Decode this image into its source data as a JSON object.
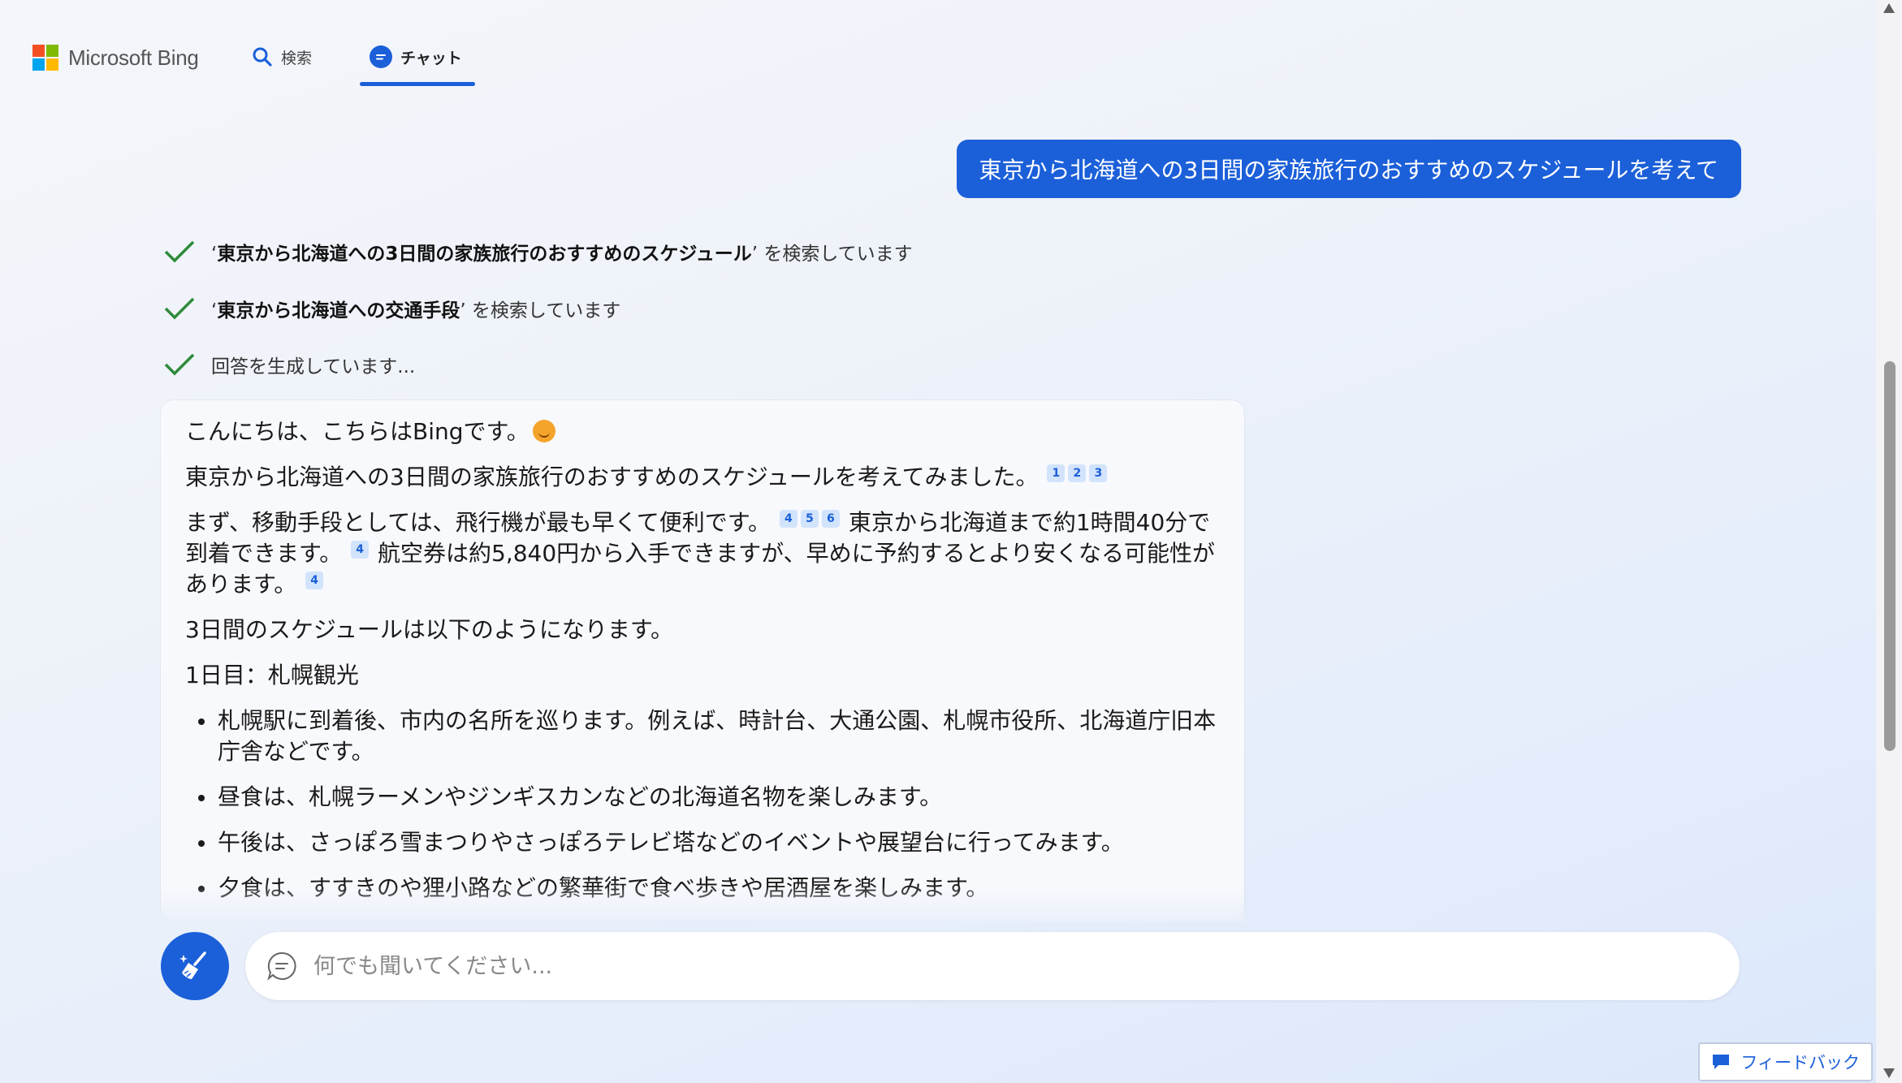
{
  "header": {
    "logo_text": "Microsoft Bing",
    "tabs": [
      {
        "label": "検索",
        "icon": "search-icon"
      },
      {
        "label": "チャット",
        "icon": "chat-icon",
        "active": true
      }
    ]
  },
  "user_message": "東京から北海道への3日間の家族旅行のおすすめのスケジュールを考えて",
  "progress": [
    {
      "query": "東京から北海道への3日間の家族旅行のおすすめのスケジュール",
      "suffix": " を検索しています"
    },
    {
      "query": "東京から北海道への交通手段",
      "suffix": " を検索しています"
    },
    {
      "text": "回答を生成しています..."
    }
  ],
  "answer": {
    "greeting": "こんにちは、こちらはBingです。",
    "p1": "東京から北海道への3日間の家族旅行のおすすめのスケジュールを考えてみました。",
    "p1_cites": [
      "1",
      "2",
      "3"
    ],
    "p2a": "まず、移動手段としては、飛行機が最も早くて便利です。",
    "p2a_cites": [
      "4",
      "5",
      "6"
    ],
    "p2b": "東京から北海道まで約1時間40分で到着できます。",
    "p2b_cites": [
      "4"
    ],
    "p2c": "航空券は約5,840円から入手できますが、早めに予約するとより安くなる可能性があります。",
    "p2c_cites": [
      "4"
    ],
    "p3": "3日間のスケジュールは以下のようになります。",
    "day1_title": "1日目：札幌観光",
    "day1_items": [
      "札幌駅に到着後、市内の名所を巡ります。例えば、時計台、大通公園、札幌市役所、北海道庁旧本庁舎などです。",
      "昼食は、札幌ラーメンやジンギスカンなどの北海道名物を楽しみます。",
      "午後は、さっぽろ雪まつりやさっぽろテレビ塔などのイベントや展望台に行ってみます。",
      "夕食は、すすきのや狸小路などの繁華街で食べ歩きや居酒屋を楽しみます。"
    ]
  },
  "input": {
    "placeholder": "何でも聞いてください..."
  },
  "feedback_label": "フィードバック",
  "colors": {
    "accent": "#1b5fd9",
    "check": "#2e8b3a"
  }
}
